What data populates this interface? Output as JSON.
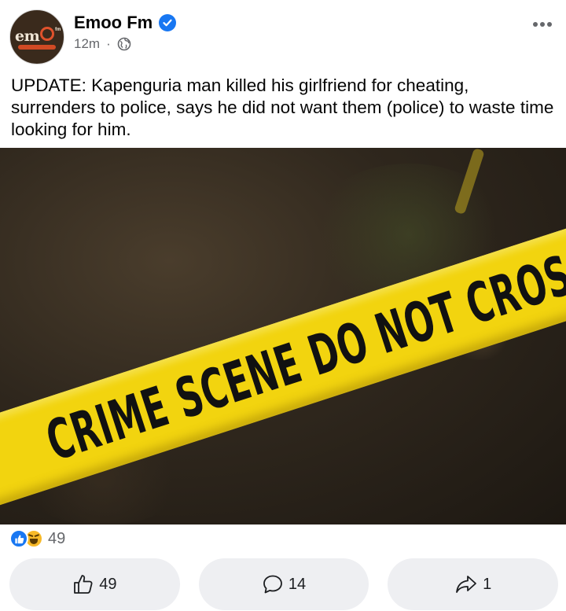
{
  "post": {
    "page_name": "Emoo Fm",
    "logo_text": "em",
    "logo_suffix": "fm",
    "time": "12m",
    "separator": "·",
    "text": "UPDATE: Kapenguria man killed his girlfriend for cheating, surrenders to police, says he did not want them (police) to waste time looking for him.",
    "image": {
      "tape_text": "CRIME SCENE DO NOT CROSS"
    }
  },
  "reactions": {
    "icons": [
      "like-icon",
      "haha-icon"
    ],
    "count": "49"
  },
  "actions": {
    "like_count": "49",
    "comment_count": "14",
    "share_count": "1"
  },
  "colors": {
    "brand_blue": "#1877f2",
    "tape_yellow": "#f2d40f",
    "button_bg": "#eeeff2",
    "meta_gray": "#65676b"
  }
}
